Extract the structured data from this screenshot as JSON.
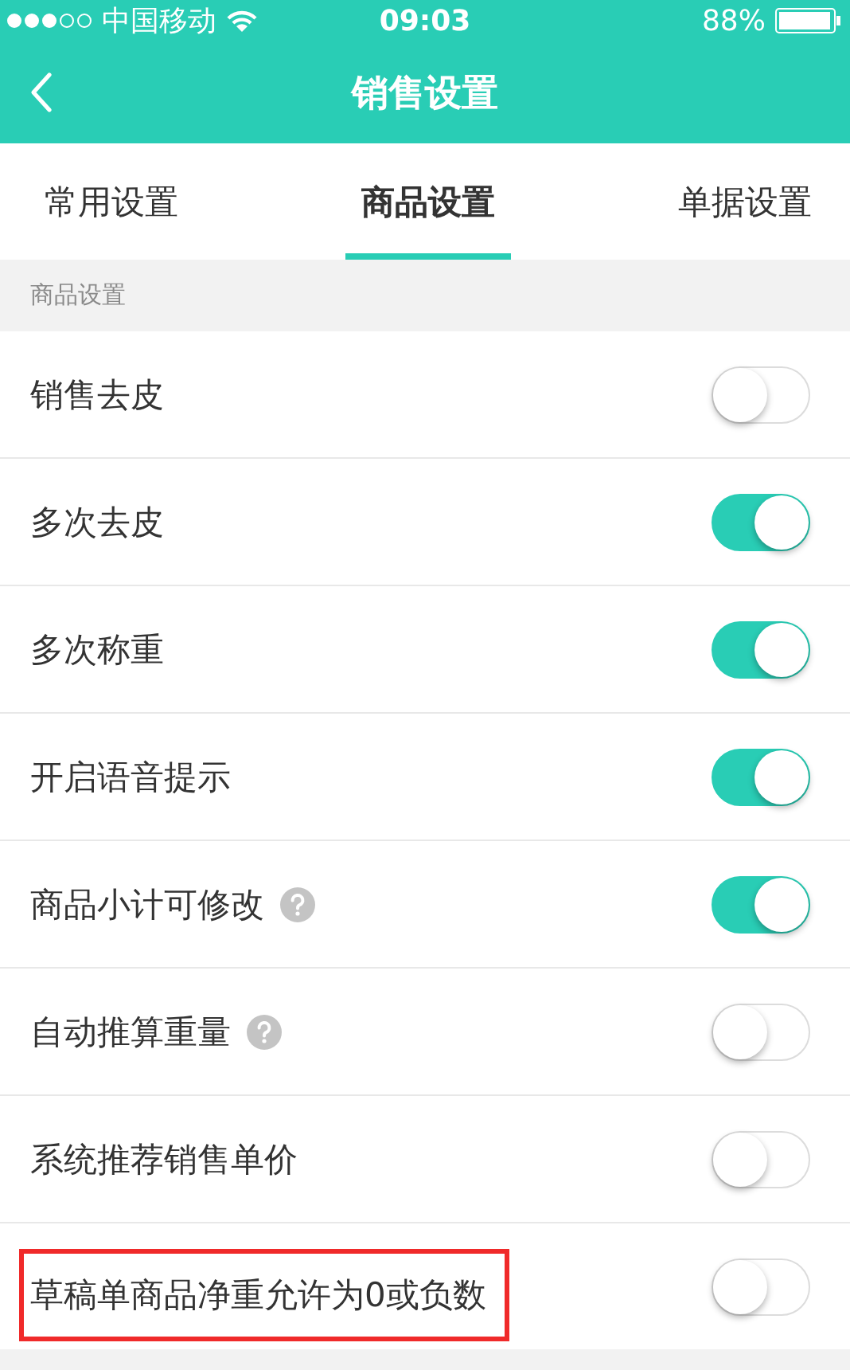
{
  "status_bar": {
    "carrier": "中国移动",
    "time": "09:03",
    "battery": "88%"
  },
  "nav": {
    "title": "销售设置"
  },
  "tabs": [
    {
      "label": "常用设置",
      "selected": false
    },
    {
      "label": "商品设置",
      "selected": true
    },
    {
      "label": "单据设置",
      "selected": false
    }
  ],
  "section": {
    "title": "商品设置"
  },
  "settings": [
    {
      "label": "销售去皮",
      "on": false,
      "help": false,
      "highlighted": false
    },
    {
      "label": "多次去皮",
      "on": true,
      "help": false,
      "highlighted": false
    },
    {
      "label": "多次称重",
      "on": true,
      "help": false,
      "highlighted": false
    },
    {
      "label": "开启语音提示",
      "on": true,
      "help": false,
      "highlighted": false
    },
    {
      "label": "商品小计可修改",
      "on": true,
      "help": true,
      "highlighted": false
    },
    {
      "label": "自动推算重量",
      "on": false,
      "help": true,
      "highlighted": false
    },
    {
      "label": "系统推荐销售单价",
      "on": false,
      "help": false,
      "highlighted": false
    },
    {
      "label": "草稿单商品净重允许为0或负数",
      "on": false,
      "help": false,
      "highlighted": true
    }
  ]
}
